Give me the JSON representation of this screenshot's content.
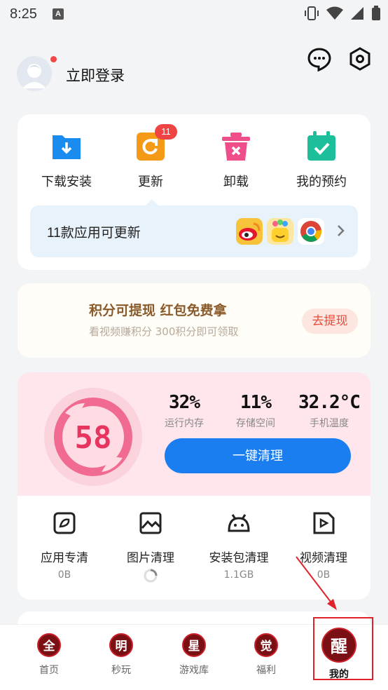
{
  "status": {
    "time": "8:25",
    "notification_badge": "A"
  },
  "header": {
    "login_text": "立即登录"
  },
  "quick_actions": [
    {
      "label": "下载安装",
      "icon": "download-icon",
      "color": "#1a8cf0"
    },
    {
      "label": "更新",
      "icon": "update-icon",
      "color": "#f59a16",
      "badge": "11"
    },
    {
      "label": "卸载",
      "icon": "trash-icon",
      "color": "#f04e8a"
    },
    {
      "label": "我的预约",
      "icon": "calendar-check-icon",
      "color": "#1dbf9a"
    }
  ],
  "update_bar": {
    "text": "11款应用可更新",
    "apps": [
      "weibo-app-icon",
      "app-icon-yellow",
      "chrome-app-icon"
    ]
  },
  "promo": {
    "title": "积分可提现 红包免费拿",
    "subtitle": "看视频赚积分 300积分即可领取",
    "button": "去提现"
  },
  "cleaner": {
    "score": "58",
    "stats": [
      {
        "value": "32%",
        "label": "运行内存"
      },
      {
        "value": "11%",
        "label": "存储空间"
      },
      {
        "value": "32.2°C",
        "label": "手机温度"
      }
    ],
    "button": "一键清理",
    "tools": [
      {
        "label": "应用专清",
        "value": "0B",
        "icon": "app-clean-icon"
      },
      {
        "label": "图片清理",
        "value": "",
        "icon": "image-icon"
      },
      {
        "label": "安装包清理",
        "value": "1.1GB",
        "icon": "android-icon"
      },
      {
        "label": "视频清理",
        "value": "0B",
        "icon": "video-icon"
      }
    ]
  },
  "tabs": [
    {
      "label": "首页",
      "glyph": "全"
    },
    {
      "label": "秒玩",
      "glyph": "明"
    },
    {
      "label": "游戏库",
      "glyph": "星"
    },
    {
      "label": "福利",
      "glyph": "觉"
    },
    {
      "label": "我的",
      "glyph": "醒",
      "active": true
    }
  ],
  "colors": {
    "accent": "#1a7ef0",
    "score": "#e8355f",
    "highlight": "#e0232a"
  }
}
